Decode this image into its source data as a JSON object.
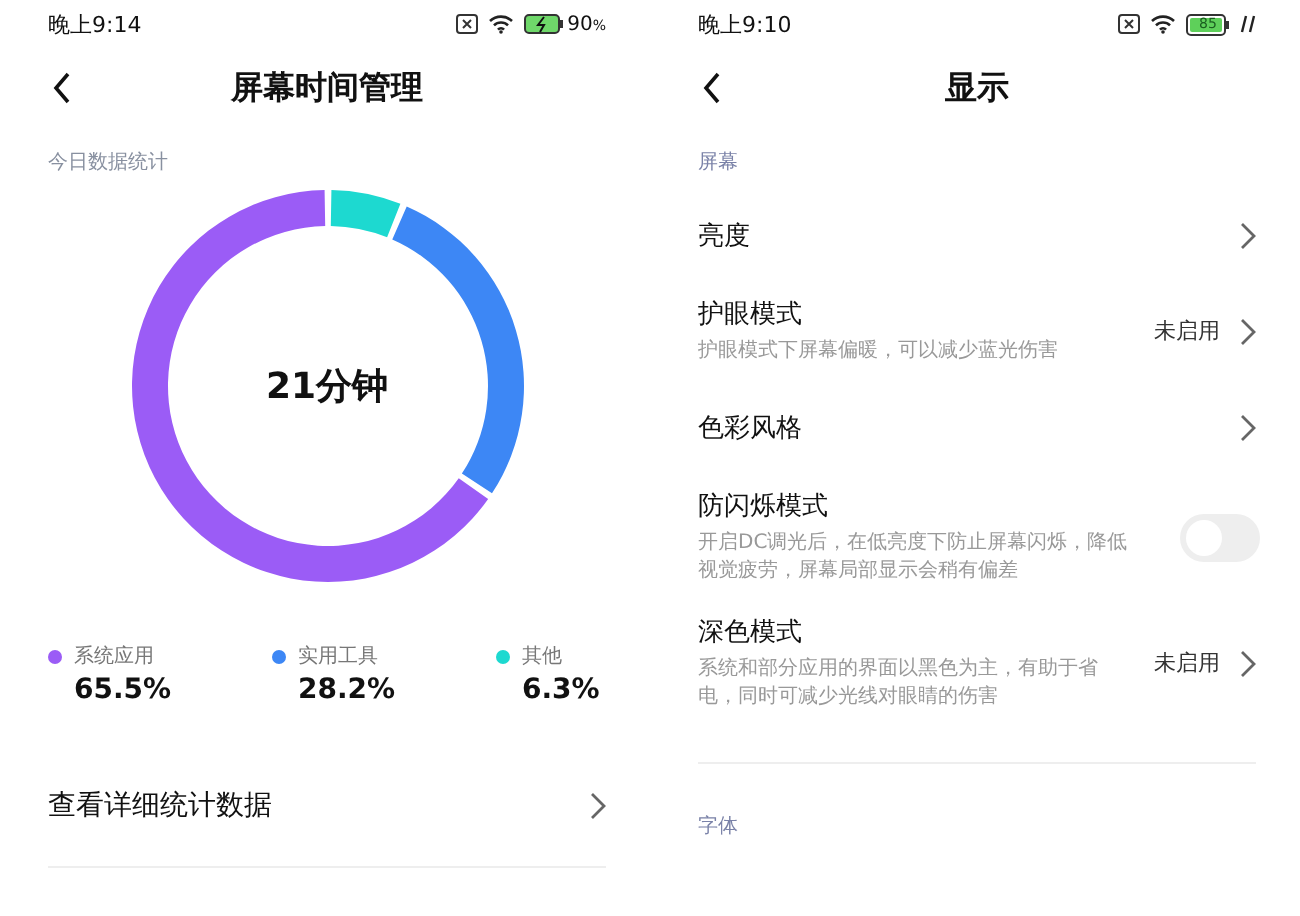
{
  "screens": [
    {
      "status_bar": {
        "time": "晚上9:14",
        "battery": "90",
        "battery_unit": "%"
      },
      "header": {
        "title": "屏幕时间管理"
      },
      "section_label": "今日数据统计",
      "chart": {
        "center_label": "21分钟",
        "chart_data": {
          "type": "donut",
          "categories": [
            "系统应用",
            "实用工具",
            "其他"
          ],
          "values": [
            65.5,
            28.2,
            6.3
          ]
        }
      },
      "legend": [
        {
          "value": "65.5%",
          "color": "#9b5cf6"
        },
        {
          "value": "28.2%",
          "color": "#3d87f5"
        },
        {
          "value": "6.3%",
          "color": "#1dd9d0"
        }
      ],
      "link_row": {
        "label": "查看详细统计数据"
      }
    },
    {
      "status_bar": {
        "time": "晚上9:10",
        "battery": "85"
      },
      "header": {
        "title": "显示"
      },
      "sections": [
        {
          "label": "屏幕",
          "items": [
            {
              "kind": "link",
              "title": "亮度"
            },
            {
              "kind": "link",
              "title": "护眼模式",
              "subtitle": "护眼模式下屏幕偏暖，可以减少蓝光伤害",
              "value": "未启用"
            },
            {
              "kind": "link",
              "title": "色彩风格"
            },
            {
              "kind": "toggle",
              "title": "防闪烁模式",
              "subtitle": "开启DC调光后，在低亮度下防止屏幕闪烁，降低视觉疲劳，屏幕局部显示会稍有偏差",
              "checked": false
            },
            {
              "kind": "link",
              "title": "深色模式",
              "subtitle": "系统和部分应用的界面以黑色为主，有助于省电，同时可减少光线对眼睛的伤害",
              "value": "未启用"
            }
          ]
        },
        {
          "label": "字体"
        }
      ]
    }
  ]
}
